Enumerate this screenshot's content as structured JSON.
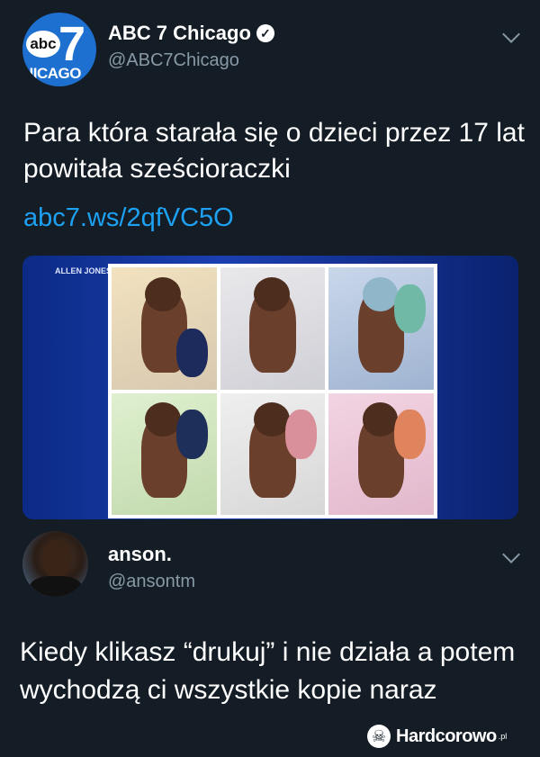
{
  "tweet": {
    "avatar": {
      "logo_abc": "abc",
      "logo_seven": "7",
      "logo_city": "HICAGO"
    },
    "name": "ABC 7 Chicago",
    "verified_icon": "verified-badge-icon",
    "handle": "@ABC7Chicago",
    "text": "Para która starała się o dzieci przez 17 lat powitała sześcioraczki",
    "link": "abc7.ws/2qfVC5O",
    "media": {
      "credit": "ALLEN JONES/VCU MARKETING",
      "photo_count": 6
    }
  },
  "reply": {
    "name": "anson.",
    "handle": "@ansontm",
    "text": "Kiedy klikasz “drukuj” i nie działa a potem wychodzą ci wszystkie kopie naraz"
  },
  "watermark": {
    "text": "Hardcorowo",
    "suffix": ".pl"
  },
  "colors": {
    "background": "#141d26",
    "link": "#1da1f2",
    "muted": "#8899a6"
  }
}
